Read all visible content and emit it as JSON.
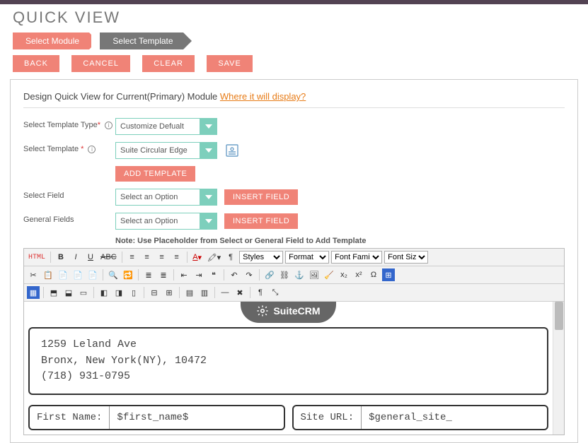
{
  "page_title": "QUICK VIEW",
  "wizard": {
    "step1": "Select Module",
    "step2": "Select Template"
  },
  "actions": {
    "back": "BACK",
    "cancel": "CANCEL",
    "clear": "CLEAR",
    "save": "SAVE"
  },
  "panel": {
    "heading_main": "Design Quick View for Current(Primary) Module ",
    "heading_link": "Where it will display?"
  },
  "form": {
    "template_type_label": "Select Template Type",
    "template_type_value": "Customize Defualt",
    "template_label": "Select Template",
    "template_value": "Suite Circular Edge",
    "add_template_btn": "ADD TEMPLATE",
    "select_field_label": "Select Field",
    "select_field_value": "Select an Option",
    "insert_field_btn": "INSERT FIELD",
    "general_fields_label": "General Fields",
    "general_fields_value": "Select an Option",
    "note": "Note: Use Placeholder from Select or General Field to Add Template"
  },
  "toolbar": {
    "styles": "Styles",
    "format": "Format",
    "font_family": "Font Family",
    "font_size": "Font Size"
  },
  "editor": {
    "brand": "SuiteCRM",
    "addr1": "1259 Leland Ave",
    "addr2": "Bronx, New York(NY), 10472",
    "phone": "(718) 931-0795",
    "field1_label": "First Name:",
    "field1_value": "$first_name$",
    "field2_label": "Site URL:",
    "field2_value": "$general_site_"
  }
}
